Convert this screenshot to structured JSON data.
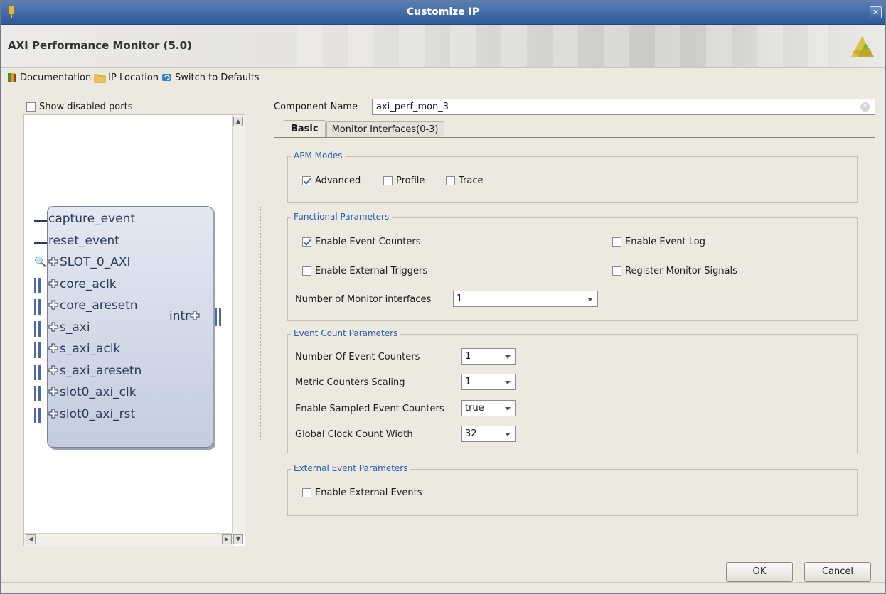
{
  "window": {
    "title": "Customize IP"
  },
  "header": {
    "ip_title": "AXI Performance Monitor (5.0)"
  },
  "toolbar": {
    "documentation_label": "Documentation",
    "ip_location_label": "IP Location",
    "switch_defaults_label": "Switch to Defaults"
  },
  "left": {
    "show_disabled_label": "Show disabled ports",
    "show_disabled_checked": false,
    "ports_left": [
      "capture_event",
      "reset_event",
      "SLOT_0_AXI",
      "core_aclk",
      "core_aresetn",
      "s_axi",
      "s_axi_aclk",
      "s_axi_aresetn",
      "slot0_axi_clk",
      "slot0_axi_rst"
    ],
    "ports_right": [
      "intr"
    ]
  },
  "component": {
    "label": "Component Name",
    "value": "axi_perf_mon_3"
  },
  "tabs": [
    {
      "label": "Basic",
      "active": true
    },
    {
      "label": "Monitor Interfaces(0-3)",
      "active": false
    }
  ],
  "apm_modes": {
    "title": "APM Modes",
    "advanced": {
      "label": "Advanced",
      "checked": true
    },
    "profile": {
      "label": "Profile",
      "checked": false
    },
    "trace": {
      "label": "Trace",
      "checked": false
    }
  },
  "functional": {
    "title": "Functional Parameters",
    "enable_event_counters": {
      "label": "Enable Event Counters",
      "checked": true
    },
    "enable_event_log": {
      "label": "Enable Event Log",
      "checked": false
    },
    "enable_external_triggers": {
      "label": "Enable External Triggers",
      "checked": false
    },
    "register_monitor_signals": {
      "label": "Register Monitor Signals",
      "checked": false
    },
    "num_monitor_label": "Number of Monitor interfaces",
    "num_monitor_value": "1"
  },
  "event_count": {
    "title": "Event Count Parameters",
    "num_event_counters_label": "Number Of Event Counters",
    "num_event_counters_value": "1",
    "metric_scaling_label": "Metric Counters Scaling",
    "metric_scaling_value": "1",
    "sampled_label": "Enable Sampled Event Counters",
    "sampled_value": "true",
    "global_clock_label": "Global Clock Count Width",
    "global_clock_value": "32"
  },
  "external_event": {
    "title": "External Event Parameters",
    "enable_external_events": {
      "label": "Enable External Events",
      "checked": false
    }
  },
  "buttons": {
    "ok": "OK",
    "cancel": "Cancel"
  },
  "colors": {
    "titlebar": "#2f5a98",
    "group_title": "#2a5bb0",
    "block_fill": "#c4ccde"
  }
}
